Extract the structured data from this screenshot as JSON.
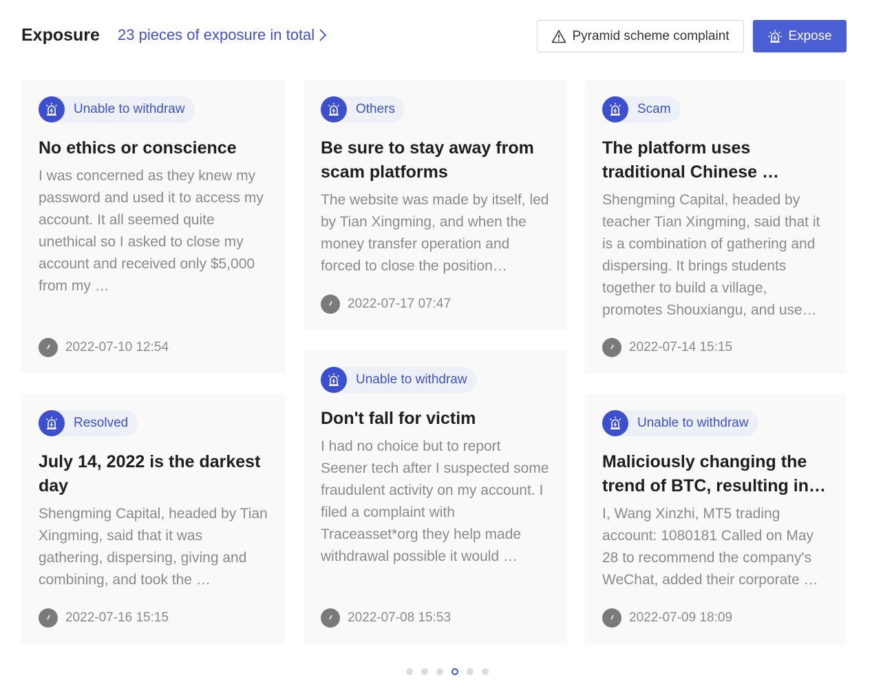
{
  "header": {
    "title": "Exposure",
    "total_link": "23 pieces of exposure in total",
    "complaint_button": "Pyramid scheme complaint",
    "expose_button": "Expose"
  },
  "cards": [
    {
      "tag": "Unable to withdraw",
      "title": "No ethics or conscience",
      "body": "I was concerned as they knew my password and used it to access my account. It all seemed quite unethical so I asked to close my account and received only $5,000 from my …",
      "date": "2022-07-10 12:54"
    },
    {
      "tag": "Others",
      "title": "Be sure to stay away from scam platforms",
      "body": "The website was made by itself, led by Tian Xingming, and when the money transfer operation and forced to close the position…",
      "date": "2022-07-17 07:47"
    },
    {
      "tag": "Scam",
      "title": "The platform uses traditional Chinese …",
      "body": "Shengming Capital, headed by teacher Tian Xingming, said that it is a combination of gathering and dispersing. It brings students together to build a village, promotes Shouxiangu, and use…",
      "date": "2022-07-14 15:15"
    },
    {
      "tag": "Resolved",
      "title": "July 14, 2022 is the darkest day",
      "body": "Shengming Capital, headed by Tian Xingming, said that it was gathering, dispersing, giving and combining, and took the …",
      "date": "2022-07-16 15:15"
    },
    {
      "tag": "Unable to withdraw",
      "title": "Don't fall for victim",
      "body": "I had no choice but to report Seener tech after I suspected some fraudulent activity on my account. I filed a complaint with Traceasset*org they help made withdrawal possible it would …",
      "date": "2022-07-08 15:53"
    },
    {
      "tag": "Unable to withdraw",
      "title": "Maliciously changing the trend of BTC, resulting in…",
      "body": "I, Wang Xinzhi, MT5 trading account: 1080181 Called on May 28 to recommend the company's WeChat, added their corporate …",
      "date": "2022-07-09 18:09"
    }
  ],
  "pagination": {
    "total_pages": 6,
    "active_index": 3
  },
  "colors": {
    "accent": "#3b4fcf",
    "button": "#4a5fd4",
    "card_bg": "#f9f9f9",
    "muted_text": "#8a8a8a"
  },
  "icons": {
    "tag": "siren-alarm-icon",
    "date": "clock-icon",
    "complaint": "warning-triangle-icon",
    "expose": "siren-alarm-icon",
    "total_link": "chevron-right-icon"
  }
}
